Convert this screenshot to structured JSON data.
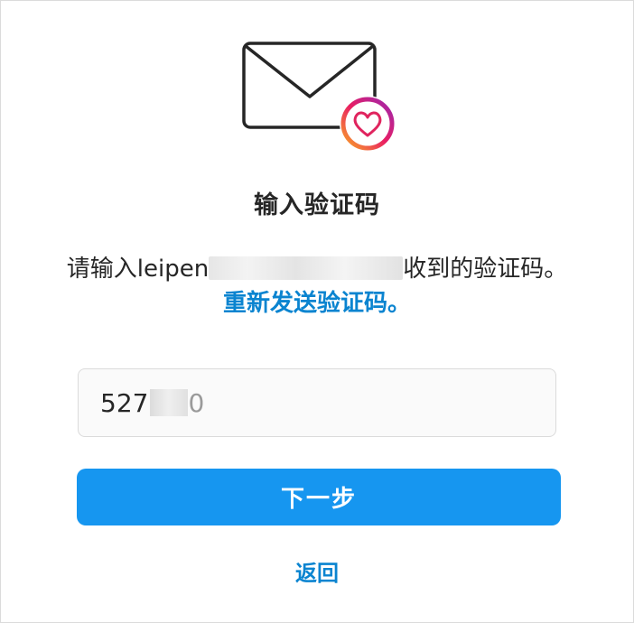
{
  "icons": {
    "envelope": "envelope-icon",
    "heart_badge": "heart-icon"
  },
  "colors": {
    "primary": "#1696f0",
    "link": "#0a84d0",
    "text": "#262626",
    "badge_gradient": [
      "#f9a825",
      "#e91e63",
      "#9c27b0"
    ]
  },
  "title": "输入验证码",
  "description": {
    "prefix": "请输入leipen",
    "suffix": "收到的验证码。",
    "resend_link": "重新发送验证码。"
  },
  "code_input": {
    "value_visible": "527",
    "value_tail": "0"
  },
  "next_button": {
    "label": "下一步"
  },
  "back_link": {
    "label": "返回"
  }
}
